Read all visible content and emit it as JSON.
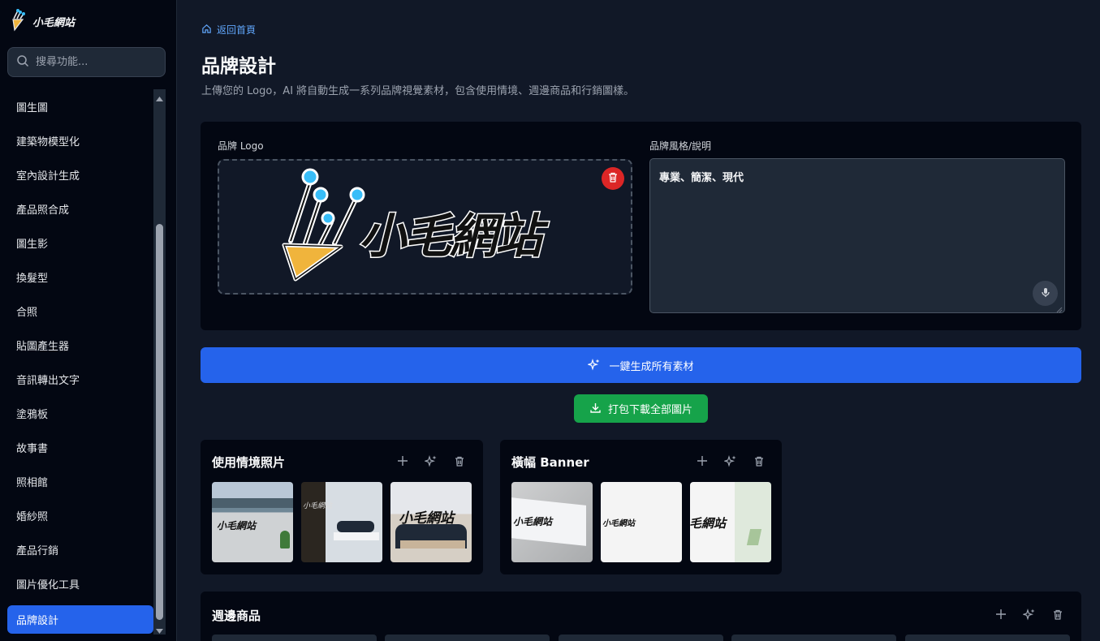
{
  "brand": {
    "name": "小毛網站"
  },
  "search": {
    "placeholder": "搜尋功能..."
  },
  "sidebar": {
    "items": [
      {
        "label": "圖生圖"
      },
      {
        "label": "建築物模型化"
      },
      {
        "label": "室內設計生成"
      },
      {
        "label": "產品照合成"
      },
      {
        "label": "圖生影"
      },
      {
        "label": "換髮型"
      },
      {
        "label": "合照"
      },
      {
        "label": "貼圖產生器"
      },
      {
        "label": "音訊轉出文字"
      },
      {
        "label": "塗鴉板"
      },
      {
        "label": "故事書"
      },
      {
        "label": "照相館"
      },
      {
        "label": "婚紗照"
      },
      {
        "label": "產品行銷"
      },
      {
        "label": "圖片優化工具"
      },
      {
        "label": "品牌設計"
      }
    ],
    "active_index": 15
  },
  "main": {
    "back_label": "返回首頁",
    "title": "品牌設計",
    "subtitle": "上傳您的 Logo，AI 將自動生成一系列品牌視覺素材，包含使用情境、週邊商品和行銷圖樣。",
    "logo_label": "品牌 Logo",
    "style_label": "品牌風格/說明",
    "style_value": "專業、簡潔、現代",
    "generate_all_label": "一鍵生成所有素材",
    "download_all_label": "打包下載全部圖片"
  },
  "sections": [
    {
      "title": "使用情境照片"
    },
    {
      "title": "橫幅 Banner"
    },
    {
      "title": "週邊商品"
    }
  ],
  "colors": {
    "accent": "#2563eb",
    "success": "#16a34a",
    "danger": "#dc2626",
    "background": "#111827",
    "panel": "#030712"
  },
  "icons": [
    "pencil-logo-icon",
    "search-icon",
    "home-icon",
    "trash-icon",
    "microphone-icon",
    "sparkles-icon",
    "download-icon",
    "plus-icon"
  ]
}
